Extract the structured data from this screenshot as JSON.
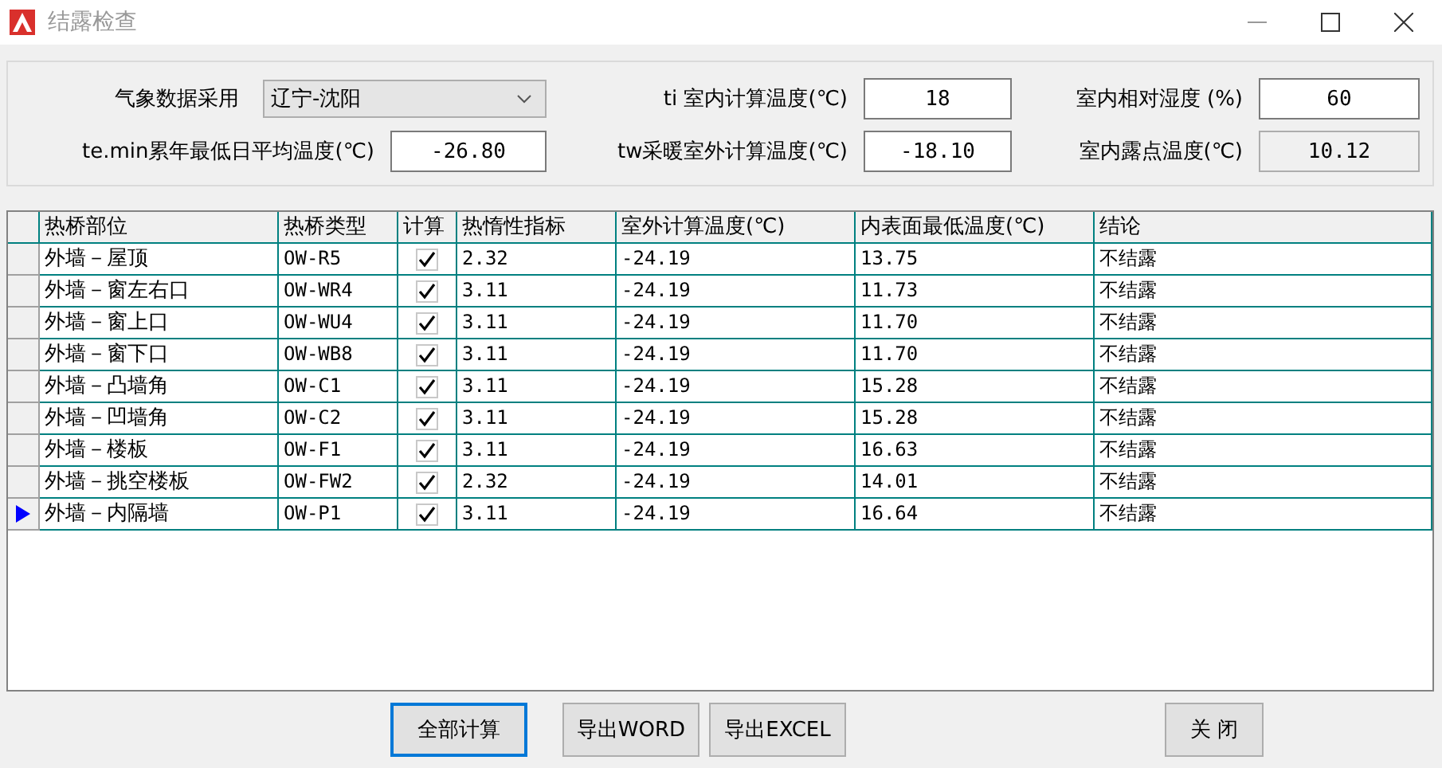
{
  "window": {
    "title": "结露检查"
  },
  "params": [
    {
      "label": "气象数据采用",
      "value": "辽宁-沈阳",
      "kind": "dropdown"
    },
    {
      "label": "ti 室内计算温度(℃)",
      "value": "18",
      "kind": "input"
    },
    {
      "label": "室内相对湿度 (%)",
      "value": "60",
      "kind": "input"
    },
    {
      "label": "te.min累年最低日平均温度(℃)",
      "value": "-26.80",
      "kind": "input"
    },
    {
      "label": "tw采暖室外计算温度(℃)",
      "value": "-18.10",
      "kind": "input"
    },
    {
      "label": "室内露点温度(℃)",
      "value": "10.12",
      "kind": "readonly"
    }
  ],
  "table": {
    "columns": [
      "热桥部位",
      "热桥类型",
      "计算",
      "热惰性指标",
      "室外计算温度(℃)",
      "内表面最低温度(℃)",
      "结论"
    ],
    "rows": [
      {
        "location": "外墙－屋顶",
        "type": "OW-R5",
        "computed": true,
        "inertia": "2.32",
        "outdoor": "-24.19",
        "inner_min": "13.75",
        "result": "不结露",
        "selected": false
      },
      {
        "location": "外墙－窗左右口",
        "type": "OW-WR4",
        "computed": true,
        "inertia": "3.11",
        "outdoor": "-24.19",
        "inner_min": "11.73",
        "result": "不结露",
        "selected": false
      },
      {
        "location": "外墙－窗上口",
        "type": "OW-WU4",
        "computed": true,
        "inertia": "3.11",
        "outdoor": "-24.19",
        "inner_min": "11.70",
        "result": "不结露",
        "selected": false
      },
      {
        "location": "外墙－窗下口",
        "type": "OW-WB8",
        "computed": true,
        "inertia": "3.11",
        "outdoor": "-24.19",
        "inner_min": "11.70",
        "result": "不结露",
        "selected": false
      },
      {
        "location": "外墙－凸墙角",
        "type": "OW-C1",
        "computed": true,
        "inertia": "3.11",
        "outdoor": "-24.19",
        "inner_min": "15.28",
        "result": "不结露",
        "selected": false
      },
      {
        "location": "外墙－凹墙角",
        "type": "OW-C2",
        "computed": true,
        "inertia": "3.11",
        "outdoor": "-24.19",
        "inner_min": "15.28",
        "result": "不结露",
        "selected": false
      },
      {
        "location": "外墙－楼板",
        "type": "OW-F1",
        "computed": true,
        "inertia": "3.11",
        "outdoor": "-24.19",
        "inner_min": "16.63",
        "result": "不结露",
        "selected": false
      },
      {
        "location": "外墙－挑空楼板",
        "type": "OW-FW2",
        "computed": true,
        "inertia": "2.32",
        "outdoor": "-24.19",
        "inner_min": "14.01",
        "result": "不结露",
        "selected": false
      },
      {
        "location": "外墙－内隔墙",
        "type": "OW-P1",
        "computed": true,
        "inertia": "3.11",
        "outdoor": "-24.19",
        "inner_min": "16.64",
        "result": "不结露",
        "selected": true
      }
    ]
  },
  "buttons": [
    {
      "label": "全部计算",
      "focused": true
    },
    {
      "label": "导出WORD",
      "focused": false
    },
    {
      "label": "导出EXCEL",
      "focused": false
    },
    {
      "label": "关 闭",
      "focused": false
    }
  ]
}
